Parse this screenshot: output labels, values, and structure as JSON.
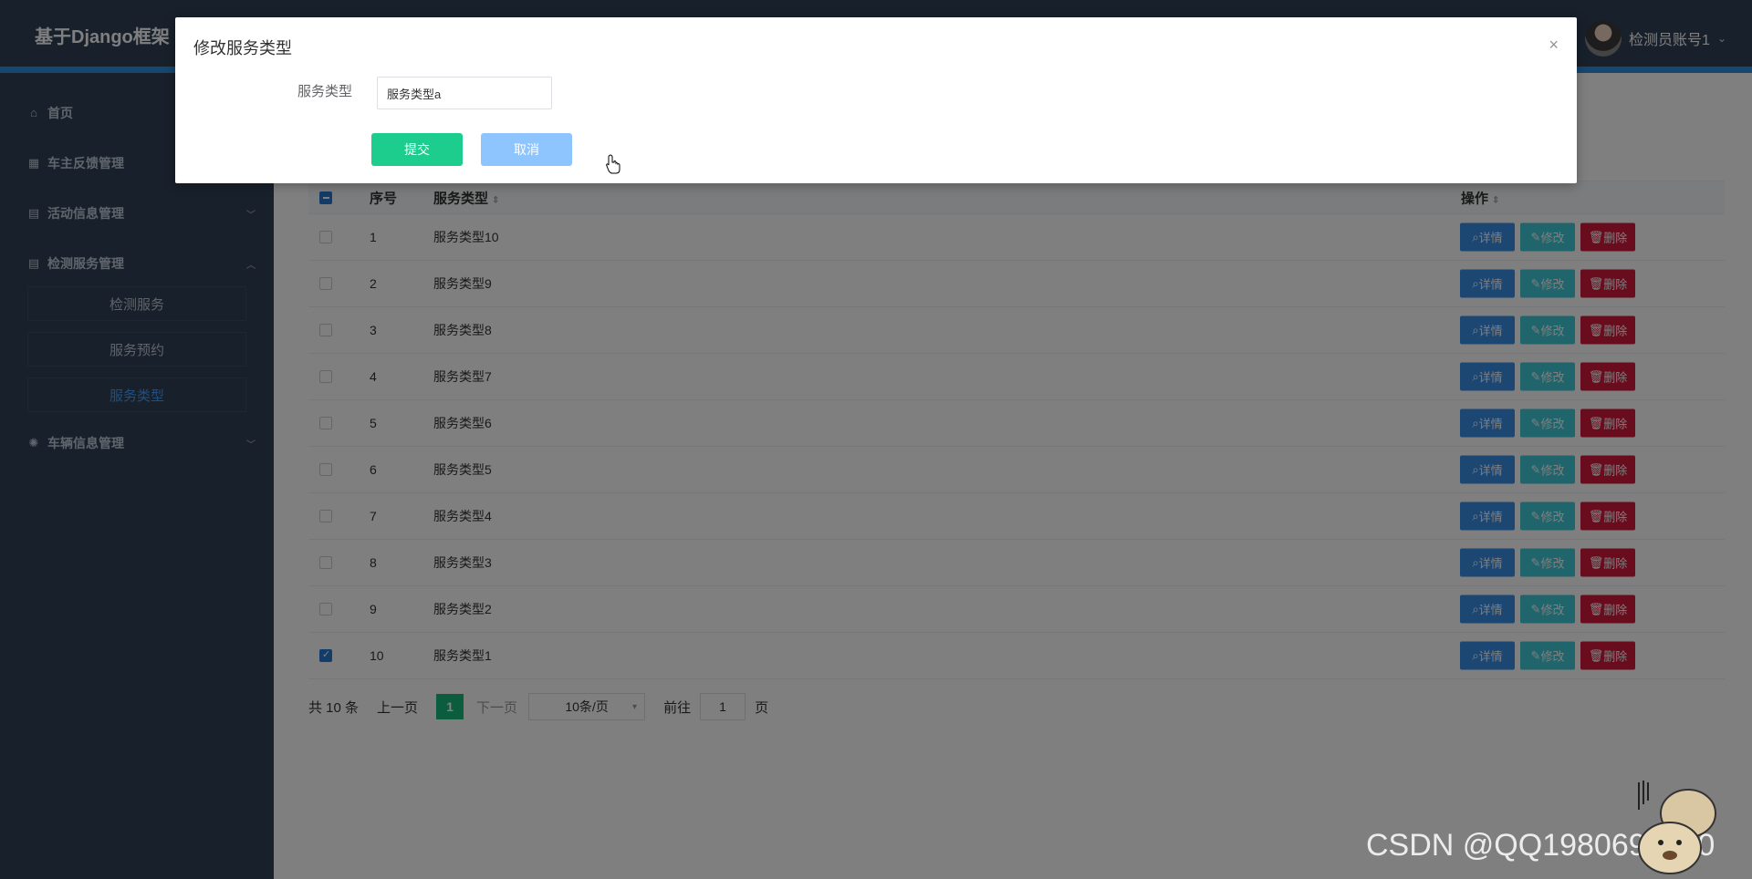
{
  "header": {
    "site_title": "基于Django框架",
    "username": "检测员账号1"
  },
  "sidebar": {
    "items": [
      {
        "label": "首页",
        "icon": "home-icon"
      },
      {
        "label": "车主反馈管理",
        "icon": "grid-icon"
      },
      {
        "label": "活动信息管理",
        "icon": "table-icon"
      },
      {
        "label": "检测服务管理",
        "icon": "table-icon"
      },
      {
        "label": "车辆信息管理",
        "icon": "gear-icon"
      }
    ],
    "submenu": [
      {
        "label": "检测服务"
      },
      {
        "label": "服务预约"
      },
      {
        "label": "服务类型"
      }
    ]
  },
  "table": {
    "headers": {
      "index": "序号",
      "type": "服务类型",
      "ops": "操作"
    },
    "rows": [
      {
        "index": "1",
        "type": "服务类型10"
      },
      {
        "index": "2",
        "type": "服务类型9"
      },
      {
        "index": "3",
        "type": "服务类型8"
      },
      {
        "index": "4",
        "type": "服务类型7"
      },
      {
        "index": "5",
        "type": "服务类型6"
      },
      {
        "index": "6",
        "type": "服务类型5"
      },
      {
        "index": "7",
        "type": "服务类型4"
      },
      {
        "index": "8",
        "type": "服务类型3"
      },
      {
        "index": "9",
        "type": "服务类型2"
      },
      {
        "index": "10",
        "type": "服务类型1"
      }
    ],
    "buttons": {
      "detail": "详情",
      "edit": "修改",
      "delete": "删除"
    }
  },
  "pagination": {
    "total": "共 10 条",
    "prev": "上一页",
    "current": "1",
    "next": "下一页",
    "page_size": "10条/页",
    "goto_label": "前往",
    "goto_value": "1",
    "page_suffix": "页"
  },
  "dialog": {
    "title": "修改服务类型",
    "close": "×",
    "field_label": "服务类型",
    "field_value": "服务类型a",
    "submit": "提交",
    "cancel": "取消"
  },
  "watermark": {
    "text": "CSDN @QQ1980691580"
  },
  "colors": {
    "sidebar_bg": "#304156",
    "accent_blue": "#409eff",
    "submit_green": "#1ccd8d",
    "cancel_blue": "#8ec5ff",
    "detail_btn": "#3a8ee6",
    "edit_btn": "#41c9d8",
    "delete_btn": "#d3183b",
    "page_active": "#18b97d"
  }
}
